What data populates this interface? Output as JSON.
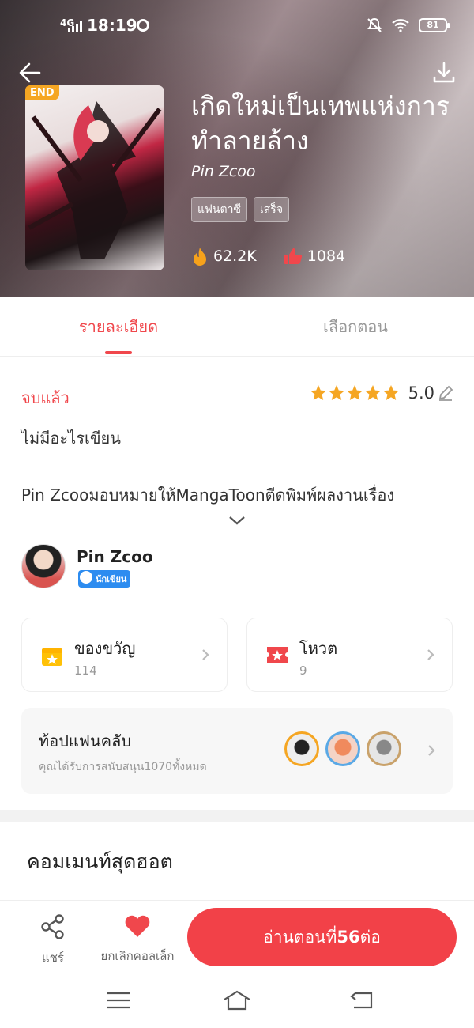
{
  "status_bar": {
    "network": "4G",
    "time": "18:19",
    "battery": "81"
  },
  "book": {
    "badge": "END",
    "title": "เกิดใหม่เป็นเทพแห่งการทำลายล้าง",
    "author": "Pin Zcoo",
    "tags": [
      "แฟนตาซี",
      "เสร็จ"
    ],
    "views": "62.2K",
    "likes": "1084"
  },
  "tabs": [
    {
      "label": "รายละเอียด",
      "active": true
    },
    {
      "label": "เลือกตอน",
      "active": false
    }
  ],
  "details": {
    "status": "จบแล้ว",
    "rating_stars": 5,
    "rating": "5.0",
    "description": "ไม่มีอะไรเขียน",
    "license": "Pin Zcooมอบหมายให้MangaToonตีดพิมพ์ผลงานเรื่อง"
  },
  "author_row": {
    "name": "Pin Zcoo",
    "badge": "นักเขียน"
  },
  "cards": {
    "gift": {
      "label": "ของขวัญ",
      "count": "114"
    },
    "vote": {
      "label": "โหวต",
      "count": "9"
    }
  },
  "fanclub": {
    "label": "ท้อปแฟนคลับ",
    "sub": "คุณได้รับการสนับสนุน1070ทั้งหมด"
  },
  "comments": {
    "title": "คอมเมนท์สุดฮอต"
  },
  "bottom": {
    "share": "แชร์",
    "unfavorite": "ยกเลิกคอลเล็ก",
    "read_prefix": "อ่านตอนที่",
    "read_num": "56",
    "read_suffix": "ต่อ"
  },
  "colors": {
    "accent": "#f0474c",
    "star": "#f5a623",
    "gift": "#ffc107",
    "vote": "#f0474c"
  }
}
